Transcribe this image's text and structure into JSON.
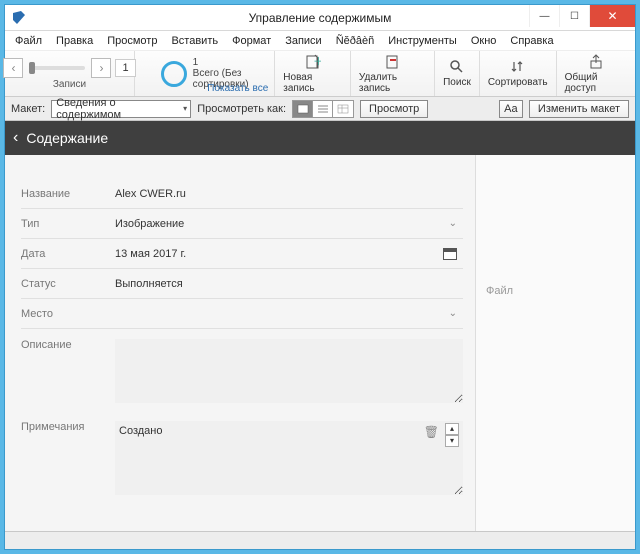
{
  "window": {
    "title": "Управление содержимым"
  },
  "menu": [
    "Файл",
    "Правка",
    "Просмотр",
    "Вставить",
    "Формат",
    "Записи",
    "Ñĕðâèñ",
    "Инструменты",
    "Окно",
    "Справка"
  ],
  "toolbar": {
    "records_label": "Записи",
    "record_num": "1",
    "total_line1": "Всего (Без",
    "total_line2": "сортировки)",
    "total_count": "1",
    "show_all": "Показать все",
    "new_record": "Новая запись",
    "delete_record": "Удалить запись",
    "search": "Поиск",
    "sort": "Сортировать",
    "share": "Общий доступ"
  },
  "layoutbar": {
    "layout_lbl": "Макет:",
    "layout_val": "Сведения о содержимом",
    "viewas_lbl": "Просмотреть как:",
    "preview": "Просмотр",
    "aa": "Aa",
    "edit_layout": "Изменить макет"
  },
  "header": {
    "title": "Содержание"
  },
  "form": {
    "name_lbl": "Название",
    "name_val": "Alex CWER.ru",
    "type_lbl": "Тип",
    "type_val": "Изображение",
    "date_lbl": "Дата",
    "date_val": "13 мая 2017 г.",
    "status_lbl": "Статус",
    "status_val": "Выполняется",
    "place_lbl": "Место",
    "place_val": "",
    "desc_lbl": "Описание",
    "notes_lbl": "Примечания",
    "notes_val": "Создано"
  },
  "side": {
    "file_lbl": "Файл"
  }
}
